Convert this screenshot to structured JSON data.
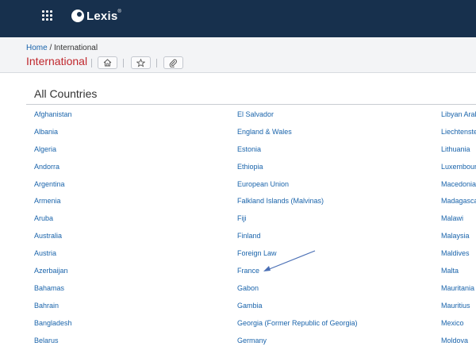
{
  "app": {
    "brand": "Lexis",
    "brand_mark": "®",
    "grid_icon": "app-grid-icon",
    "accent": "#17304d"
  },
  "breadcrumb": {
    "home": "Home",
    "separator": " / ",
    "current": "International"
  },
  "page": {
    "title": "International",
    "title_color": "#c0272d"
  },
  "toolbar": {
    "icons": [
      "home-icon",
      "star-icon",
      "paperclip-icon"
    ]
  },
  "section": {
    "title": "All Countries"
  },
  "columns": [
    [
      "Afghanistan",
      "Albania",
      "Algeria",
      "Andorra",
      "Argentina",
      "Armenia",
      "Aruba",
      "Australia",
      "Austria",
      "Azerbaijan",
      "Bahamas",
      "Bahrain",
      "Bangladesh",
      "Belarus"
    ],
    [
      "El Salvador",
      "England & Wales",
      "Estonia",
      "Ethiopia",
      "European Union",
      "Falkland Islands (Malvinas)",
      "Fiji",
      "Finland",
      "Foreign Law",
      "France",
      "Gabon",
      "Gambia",
      "Georgia (Former Republic of Georgia)",
      "Germany"
    ],
    [
      "Libyan Arab",
      "Liechtenste",
      "Lithuania",
      "Luxembour",
      "Macedonia",
      "Madagasca",
      "Malawi",
      "Malaysia",
      "Maldives",
      "Malta",
      "Mauritania",
      "Mauritius",
      "Mexico",
      "Moldova"
    ]
  ],
  "annotation": {
    "color": "#4a6fb5"
  }
}
